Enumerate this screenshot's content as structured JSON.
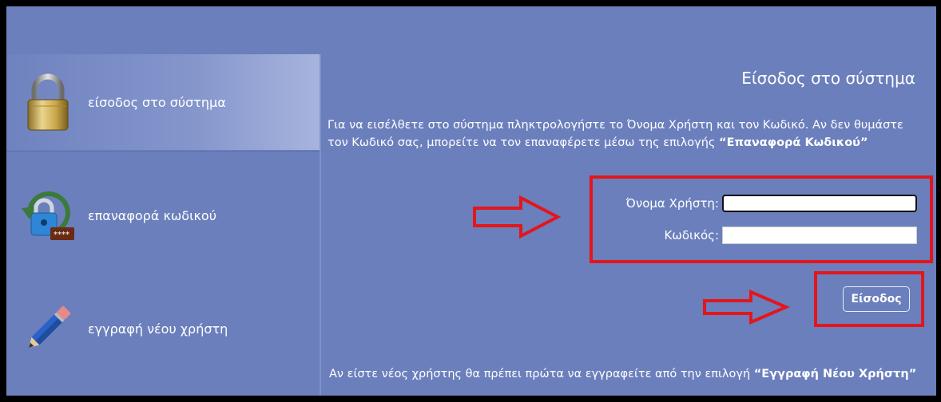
{
  "sidebar": {
    "items": [
      {
        "label": "είσοδος στο σύστημα",
        "icon": "padlock-icon",
        "active": true
      },
      {
        "label": "επαναφορά κωδικού",
        "icon": "password-reset-icon",
        "active": false
      },
      {
        "label": "εγγραφή νέου χρήστη",
        "icon": "pencil-icon",
        "active": false
      }
    ]
  },
  "main": {
    "title": "Είσοδος στο σύστημα",
    "intro": {
      "text": "Για να εισέλθετε στο σύστημα πληκτρολογήστε το Όνομα Χρήστη και τον Κωδικό. Αν δεν θυμάστε τον Κωδικό σας, μπορείτε να τον επαναφέρετε μέσω της επιλογής ",
      "link": "“Επαναφορά Κωδικού”"
    },
    "form": {
      "username_label": "Όνομα Χρήστη:",
      "username_value": "",
      "password_label": "Κωδικός:",
      "password_value": "",
      "submit_label": "Είσοδος"
    },
    "footer": {
      "text": "Αν είστε νέος χρήστης θα πρέπει πρώτα να εγγραφείτε από την επιλογή ",
      "link": "“Εγγραφή Νέου Χρήστη”"
    }
  },
  "colors": {
    "background": "#6b7fbc",
    "annotation": "#e3161b",
    "text": "#ffffff"
  }
}
